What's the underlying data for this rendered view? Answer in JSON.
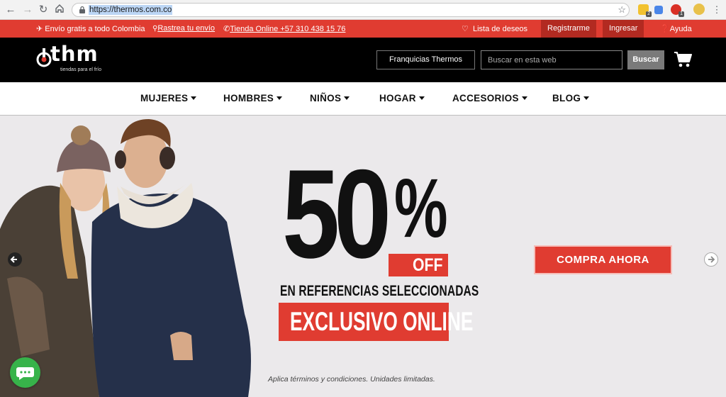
{
  "browser": {
    "url": "https://thermos.com.co"
  },
  "topbar": {
    "shipping": "✈ Envío gratis a todo Colombia",
    "track": "Rastrea tu envío",
    "phone": "Tienda Online +57 310 438 15 76",
    "wishlist": "Lista de deseos",
    "register": "Registrarme",
    "login": "Ingresar",
    "help": "Ayuda"
  },
  "header": {
    "logo_text": "thm",
    "logo_tagline": "tiendas para el frío",
    "franchises_label": "Franquicias Thermos",
    "search_placeholder": "Buscar en esta web",
    "search_button": "Buscar"
  },
  "nav": {
    "items": [
      "MUJERES",
      "HOMBRES",
      "NIÑOS",
      "HOGAR",
      "ACCESORIOS",
      "BLOG"
    ]
  },
  "hero": {
    "discount_number": "50",
    "percent_sign": "%",
    "off_label": "OFF",
    "subtitle": "EN REFERENCIAS SELECCIONADAS",
    "exclusive": "EXCLUSIVO ONLINE",
    "cta": "COMPRA AHORA",
    "terms": "Aplica términos y condiciones. Unidades limitadas."
  },
  "colors": {
    "brand_red": "#e03c31",
    "header_black": "#000000",
    "chat_green": "#37b34a"
  }
}
